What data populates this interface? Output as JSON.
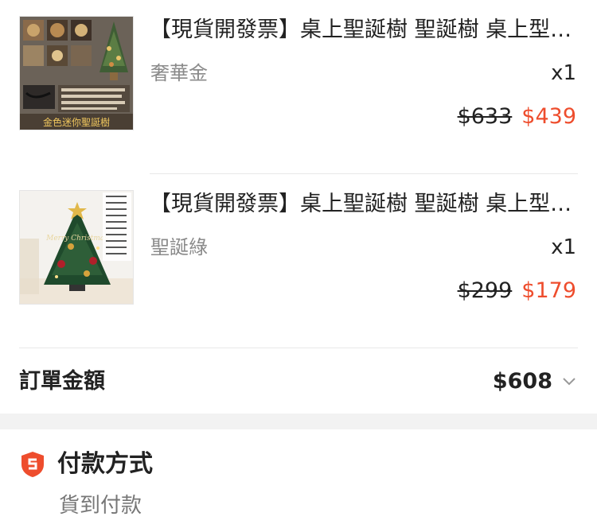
{
  "items": [
    {
      "title": "【現貨開發票】桌上聖誕樹 聖誕樹 桌上型聖誕樹",
      "variant": "奢華金",
      "quantity": "x1",
      "original_price": "$633",
      "sale_price": "$439",
      "image_caption": "金色迷你聖誕樹"
    },
    {
      "title": "【現貨開發票】桌上聖誕樹 聖誕樹 桌上型聖誕樹",
      "variant": "聖誕綠",
      "quantity": "x1",
      "original_price": "$299",
      "sale_price": "$179",
      "image_caption": "Merry Christmas"
    }
  ],
  "order_total": {
    "label": "訂單金額",
    "value": "$608"
  },
  "payment": {
    "title": "付款方式",
    "method": "貨到付款"
  },
  "colors": {
    "accent": "#ee4d2d",
    "muted": "#8a8a8a",
    "divider": "#e8e8e8",
    "section_gap": "#f2f2f2"
  }
}
